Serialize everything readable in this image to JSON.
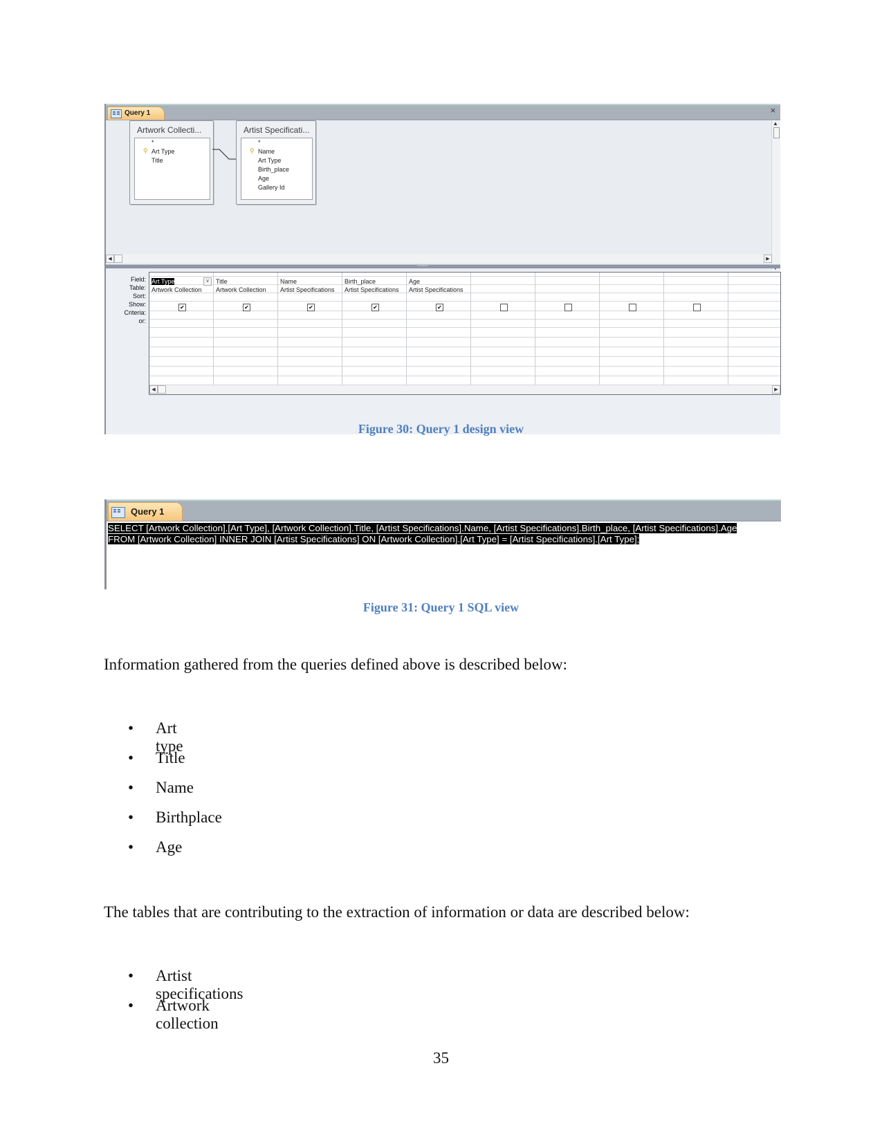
{
  "figure30": {
    "tab_label": "Query 1",
    "tables": [
      {
        "name": "Artwork Collecti...",
        "fields": [
          "*",
          "Art Type",
          "Title"
        ],
        "primary_key": "Art Type"
      },
      {
        "name": "Artist Specificati...",
        "fields": [
          "*",
          "Name",
          "Art Type",
          "Birth_place",
          "Age",
          "Gallery Id"
        ],
        "primary_key": "Name"
      }
    ],
    "row_labels": [
      "Field:",
      "Table:",
      "Sort:",
      "Show:",
      "Criteria:",
      "or:"
    ],
    "columns": [
      {
        "field": "Art Type",
        "table": "Artwork Collection",
        "show": true,
        "selected": true
      },
      {
        "field": "Title",
        "table": "Artwork Collection",
        "show": true
      },
      {
        "field": "Name",
        "table": "Artist Specifications",
        "show": true
      },
      {
        "field": "Birth_place",
        "table": "Artist Specifications",
        "show": true
      },
      {
        "field": "Age",
        "table": "Artist Specifications",
        "show": true
      },
      {
        "field": "",
        "table": "",
        "show": false
      },
      {
        "field": "",
        "table": "",
        "show": false
      },
      {
        "field": "",
        "table": "",
        "show": false
      },
      {
        "field": "",
        "table": "",
        "show": false
      }
    ],
    "caption": "Figure 30: Query 1 design view"
  },
  "figure31": {
    "tab_label": "Query 1",
    "sql_lines": [
      "SELECT [Artwork Collection].[Art Type], [Artwork Collection].Title, [Artist Specifications].Name, [Artist Specifications].Birth_place, [Artist Specifications].Age",
      "FROM [Artwork Collection] INNER JOIN [Artist Specifications] ON [Artwork Collection].[Art Type] = [Artist Specifications].[Art Type];"
    ],
    "caption": "Figure 31: Query 1 SQL view"
  },
  "body": {
    "intro1": "Information gathered from the queries defined above is described below:",
    "list1": [
      "Art type",
      "Title",
      "Name",
      "Birthplace",
      "Age"
    ],
    "intro2": "The tables that are contributing to the extraction of information or data are described below:",
    "list2": [
      "Artist specifications",
      "Artwork collection"
    ],
    "bullet": "•"
  },
  "page_number": "35",
  "icons": {
    "close": "×",
    "checked": "✔",
    "scroll_up": "▲",
    "scroll_down": "▼",
    "scroll_left": "◀",
    "scroll_right": "▶",
    "dropdown": "v",
    "key": "🔑"
  }
}
